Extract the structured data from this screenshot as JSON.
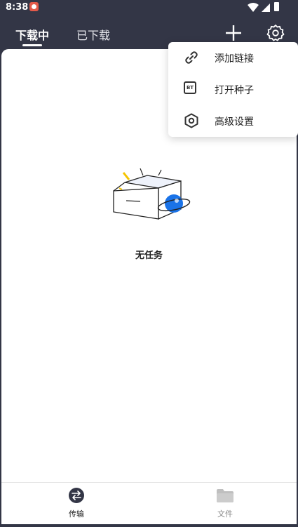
{
  "status_bar": {
    "time": "8:38"
  },
  "header": {
    "tabs": [
      {
        "label": "下载中",
        "active": true
      },
      {
        "label": "已下载",
        "active": false
      }
    ]
  },
  "main": {
    "empty_state_text": "无任务"
  },
  "menu": {
    "items": [
      {
        "label": "添加链接",
        "icon": "link-icon"
      },
      {
        "label": "打开种子",
        "icon": "bt-torrent-icon",
        "icon_text": "BT"
      },
      {
        "label": "高级设置",
        "icon": "hex-settings-icon"
      }
    ]
  },
  "bottom_nav": {
    "items": [
      {
        "label": "传输",
        "icon": "transfer-icon",
        "active": true
      },
      {
        "label": "文件",
        "icon": "folder-icon",
        "active": false
      }
    ]
  },
  "colors": {
    "header_bg": "#333646",
    "accent_blue": "#1a73e8",
    "accent_yellow": "#f5c400"
  }
}
